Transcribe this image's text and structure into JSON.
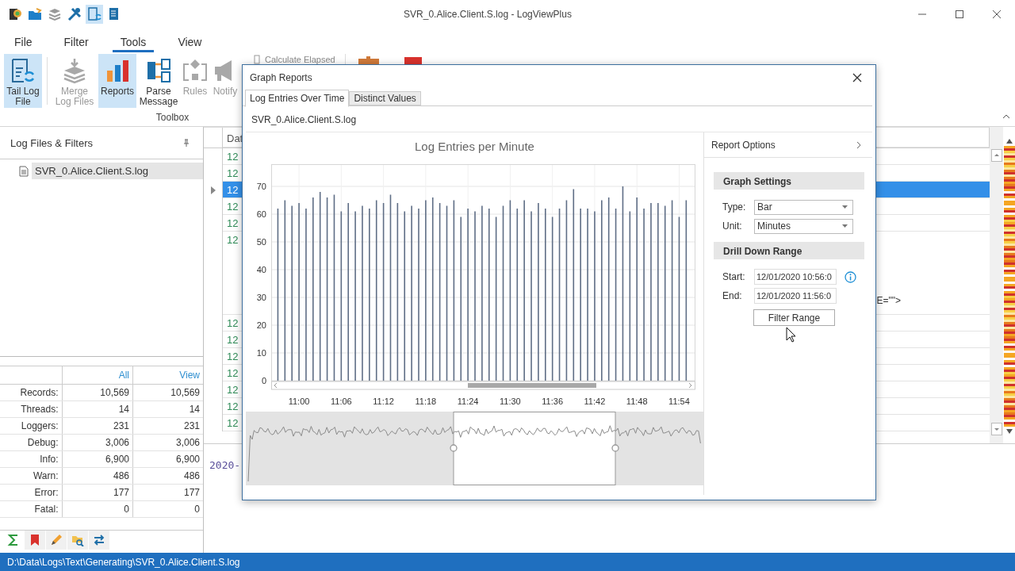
{
  "window": {
    "title": "SVR_0.Alice.Client.S.log - LogViewPlus"
  },
  "quick_access": [
    {
      "kind": "app",
      "selected": false
    },
    {
      "kind": "open",
      "selected": false
    },
    {
      "kind": "merge",
      "selected": false
    },
    {
      "kind": "tools",
      "selected": false
    },
    {
      "kind": "tail",
      "selected": true
    },
    {
      "kind": "report",
      "selected": false
    }
  ],
  "menu": [
    {
      "label": "File",
      "selected": false
    },
    {
      "label": "Filter",
      "selected": false
    },
    {
      "label": "Tools",
      "selected": true
    },
    {
      "label": "View",
      "selected": false
    }
  ],
  "ribbon": {
    "buttons": [
      {
        "label": "Tail Log File",
        "kind": "tail",
        "selected": true,
        "disabled": false
      },
      {
        "label": "Merge Log Files",
        "kind": "merge",
        "selected": false,
        "disabled": true
      },
      {
        "label": "Reports",
        "kind": "reports",
        "selected": true,
        "disabled": false
      },
      {
        "label": "Parse Message",
        "kind": "parse",
        "selected": false,
        "disabled": false
      },
      {
        "label": "Rules",
        "kind": "rules",
        "selected": false,
        "disabled": true
      },
      {
        "label": "Notify",
        "kind": "notify",
        "selected": false,
        "disabled": true
      }
    ],
    "small_button": {
      "label": "Calculate Elapsed",
      "disabled": true
    },
    "group_label": "Toolbox"
  },
  "left_panel": {
    "title": "Log Files & Filters",
    "files": [
      {
        "name": "SVR_0.Alice.Client.S.log",
        "selected": true
      }
    ],
    "stats": {
      "columns": [
        "All",
        "View"
      ],
      "rows": [
        {
          "label": "Records:",
          "all": "10,569",
          "view": "10,569"
        },
        {
          "label": "Threads:",
          "all": "14",
          "view": "14"
        },
        {
          "label": "Loggers:",
          "all": "231",
          "view": "231"
        },
        {
          "label": "Debug:",
          "all": "3,006",
          "view": "3,006"
        },
        {
          "label": "Info:",
          "all": "6,900",
          "view": "6,900"
        },
        {
          "label": "Warn:",
          "all": "486",
          "view": "486"
        },
        {
          "label": "Error:",
          "all": "177",
          "view": "177"
        },
        {
          "label": "Fatal:",
          "all": "0",
          "view": "0"
        }
      ]
    },
    "bottom_tabs": [
      {
        "kind": "sum",
        "selected": true
      },
      {
        "kind": "bookmark",
        "selected": false
      },
      {
        "kind": "edit",
        "selected": false
      },
      {
        "kind": "search",
        "selected": false
      },
      {
        "kind": "swap",
        "selected": false
      }
    ]
  },
  "grid": {
    "header": "Dat",
    "rows": [
      {
        "cell": "12",
        "selected": false
      },
      {
        "cell": "12",
        "selected": false
      },
      {
        "cell": "12",
        "selected": true
      },
      {
        "cell": "12",
        "selected": false
      },
      {
        "cell": "12",
        "selected": false
      },
      {
        "cell": "12",
        "selected": false,
        "tail": "E=\"\">"
      },
      {
        "cell": "12",
        "selected": false
      },
      {
        "cell": "12",
        "selected": false
      },
      {
        "cell": "12",
        "selected": false
      },
      {
        "cell": "12",
        "selected": false
      },
      {
        "cell": "12",
        "selected": false
      },
      {
        "cell": "12",
        "selected": false
      },
      {
        "cell": "12",
        "selected": false
      }
    ],
    "detail": "2020-"
  },
  "dialog": {
    "title": "Graph Reports",
    "tabs": [
      {
        "label": "Log Entries Over Time",
        "selected": true
      },
      {
        "label": "Distinct Values",
        "selected": false
      }
    ],
    "file": "SVR_0.Alice.Client.S.log",
    "chart_data": {
      "type": "bar",
      "title": "Log Entries per Minute",
      "categories": [
        null,
        null,
        null,
        "11:00",
        null,
        null,
        null,
        null,
        null,
        "11:06",
        null,
        null,
        null,
        null,
        null,
        "11:12",
        null,
        null,
        null,
        null,
        null,
        "11:18",
        null,
        null,
        null,
        null,
        null,
        "11:24",
        null,
        null,
        null,
        null,
        null,
        "11:30",
        null,
        null,
        null,
        null,
        null,
        "11:36",
        null,
        null,
        null,
        null,
        null,
        "11:42",
        null,
        null,
        null,
        null,
        null,
        "11:48",
        null,
        null,
        null,
        null,
        null,
        "11:54",
        null
      ],
      "values": [
        62,
        65,
        63,
        64,
        62,
        66,
        68,
        66,
        67,
        61,
        64,
        61,
        63,
        62,
        65,
        64,
        67,
        64,
        61,
        63,
        62,
        65,
        66,
        64,
        63,
        65,
        59,
        62,
        61,
        63,
        62,
        59,
        63,
        65,
        62,
        65,
        61,
        64,
        62,
        59,
        62,
        65,
        69,
        62,
        62,
        61,
        65,
        66,
        62,
        70,
        61,
        66,
        62,
        64,
        64,
        63,
        65,
        59,
        65
      ],
      "ylim": [
        0,
        78
      ],
      "grid": true,
      "yticks": [
        0,
        10,
        20,
        30,
        40,
        50,
        60,
        70
      ]
    },
    "options": {
      "title": "Report Options",
      "sections": [
        {
          "title": "Graph Settings",
          "fields": [
            {
              "kind": "select",
              "label": "Type:",
              "value": "Bar"
            },
            {
              "kind": "select",
              "label": "Unit:",
              "value": "Minutes"
            }
          ]
        },
        {
          "title": "Drill Down Range",
          "fields": [
            {
              "kind": "text",
              "label": "Start:",
              "value": "12/01/2020 10:56:0",
              "info": true
            },
            {
              "kind": "text",
              "label": "End:",
              "value": "12/01/2020 11:56:0"
            }
          ]
        }
      ],
      "button": "Filter Range"
    }
  },
  "status_bar": {
    "path": "D:\\Data\\Logs\\Text\\Generating\\SVR_0.Alice.Client.S.log"
  }
}
